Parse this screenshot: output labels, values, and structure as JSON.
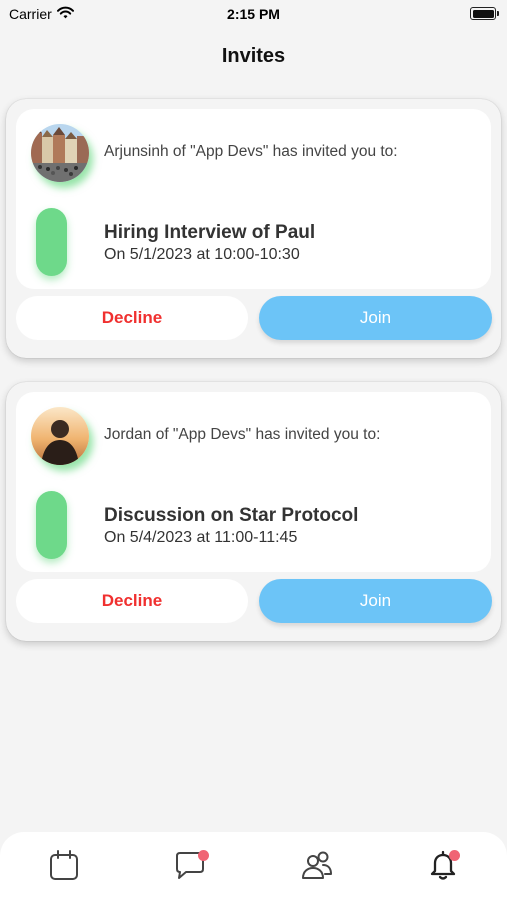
{
  "status_bar": {
    "carrier": "Carrier",
    "time": "2:15 PM"
  },
  "header": {
    "title": "Invites"
  },
  "invites": [
    {
      "invite_text": "Arjunsinh of \"App Devs\" has invited you to:",
      "event_title": "Hiring Interview of Paul",
      "event_time": "On 5/1/2023 at 10:00-10:30",
      "decline_label": "Decline",
      "join_label": "Join"
    },
    {
      "invite_text": "Jordan of \"App Devs\" has invited you to:",
      "event_title": "Discussion on Star Protocol",
      "event_time": "On 5/4/2023 at 11:00-11:45",
      "decline_label": "Decline",
      "join_label": "Join"
    }
  ],
  "tab_bar": {
    "items": [
      {
        "icon": "calendar-icon",
        "badge": false
      },
      {
        "icon": "chat-icon",
        "badge": true
      },
      {
        "icon": "people-icon",
        "badge": false
      },
      {
        "icon": "bell-icon",
        "badge": true
      }
    ]
  },
  "colors": {
    "status_pill": "#6ed98a",
    "decline": "#f0302f",
    "join": "#6cc4f7",
    "badge": "#f06474",
    "background": "#f4f4f4"
  }
}
